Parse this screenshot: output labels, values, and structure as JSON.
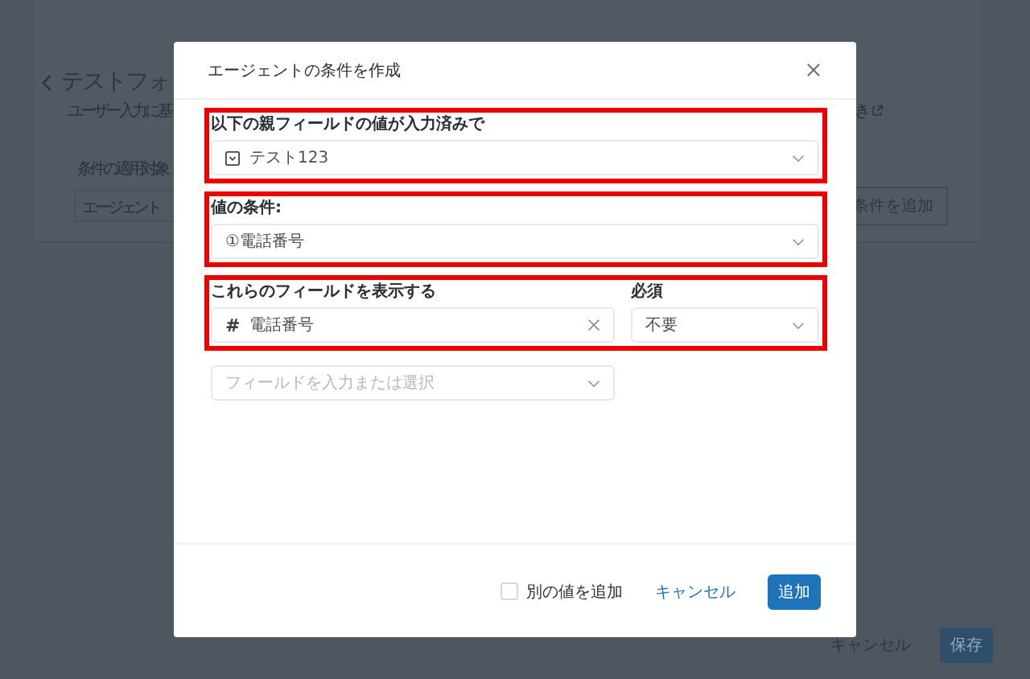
{
  "background": {
    "title": "テストフォ",
    "subtitle": "ユーザー入力に基",
    "side_text": "き",
    "section_label": "条件の適用対象",
    "select_value": "エージェント",
    "add_button": "条件を追加",
    "cancel_button": "キャンセル",
    "save_button": "保存"
  },
  "dialog": {
    "title": "エージェントの条件を作成",
    "sections": [
      {
        "kind": "parent-field",
        "highlighted": true,
        "label": "以下の親フィールドの値が入力済みで",
        "value": "テスト123"
      },
      {
        "kind": "value-condition",
        "highlighted": true,
        "label": "値の条件:",
        "value": "①電話番号"
      },
      {
        "kind": "fields",
        "highlighted": true,
        "label": "これらのフィールドを表示する",
        "required_label": "必須",
        "prefix": "#",
        "value": "電話番号",
        "required": "不要"
      },
      {
        "kind": "field-picker",
        "highlighted": false,
        "placeholder": "フィールドを入力または選択"
      }
    ],
    "footer": {
      "checkbox": {
        "label": "別の値を追加",
        "checked": false
      },
      "cancel": "キャンセル",
      "add": "追加"
    }
  }
}
